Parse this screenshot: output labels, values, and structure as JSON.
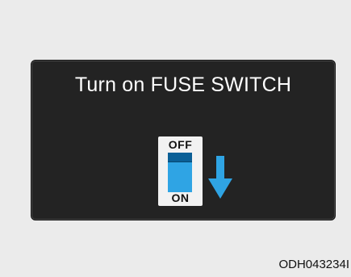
{
  "panel": {
    "message": "Turn on FUSE SWITCH"
  },
  "switch": {
    "off_label": "OFF",
    "on_label": "ON",
    "arrow_icon": "down-arrow-icon",
    "accent_color": "#2fa4e4"
  },
  "image_code": "ODH043234I"
}
